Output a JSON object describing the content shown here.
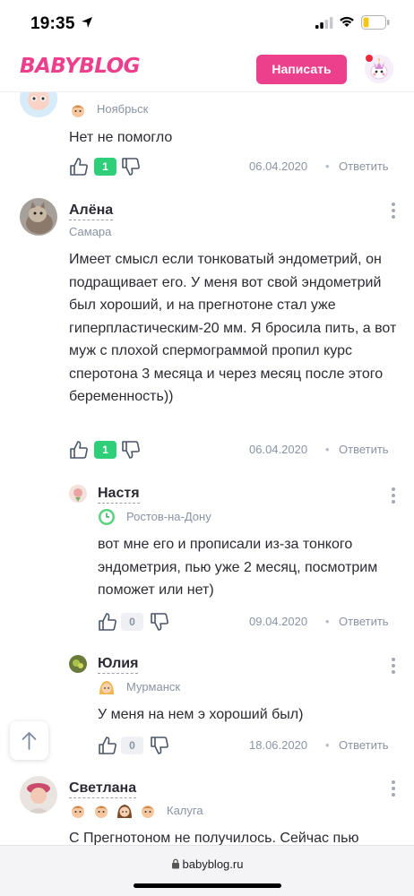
{
  "status": {
    "time": "19:35"
  },
  "header": {
    "logo": "BABYBLOG",
    "write_button": "Написать"
  },
  "comments": [
    {
      "author": "",
      "city": "Ноябрьск",
      "text": "Нет не помогло",
      "likes": "1",
      "date": "06.04.2020",
      "reply": "Ответить"
    },
    {
      "author": "Алёна",
      "city": "Самара",
      "text": "Имеет смысл если тонковатый эндометрий, он подращивает его. У меня вот свой эндометрий был хороший, и на прегнотоне стал уже гиперпластическим-20 мм. Я бросила пить, а вот муж с плохой спермограммой пропил курс сперотона 3 месяца и через месяц после этого беременность))",
      "likes": "1",
      "date": "06.04.2020",
      "reply": "Ответить"
    },
    {
      "author": "Настя",
      "city": "Ростов-на-Дону",
      "text": "вот мне его и прописали из-за тонкого эндометрия, пью уже 2 месяц, посмотрим поможет или нет)",
      "likes": "0",
      "date": "09.04.2020",
      "reply": "Ответить"
    },
    {
      "author": "Юлия",
      "city": "Мурманск",
      "text": "У меня на нем э хороший был)",
      "likes": "0",
      "date": "18.06.2020",
      "reply": "Ответить"
    },
    {
      "author": "Светлана",
      "city": "Калуга",
      "text": "С Прегнотоном не получилось. Сейчас пью"
    }
  ],
  "url_bar": {
    "url": "babyblog.ru"
  },
  "colors": {
    "brand": "#ec3f8c",
    "like_positive": "#2fce79",
    "muted": "#8a93a3"
  },
  "icons": [
    "location-arrow-icon",
    "signal-icon",
    "wifi-icon",
    "battery-icon",
    "thumb-up-icon",
    "thumb-down-icon",
    "more-dots-icon",
    "arrow-up-icon",
    "lock-icon",
    "child-badge-icon",
    "clock-badge-icon",
    "girl-badge-icon"
  ]
}
